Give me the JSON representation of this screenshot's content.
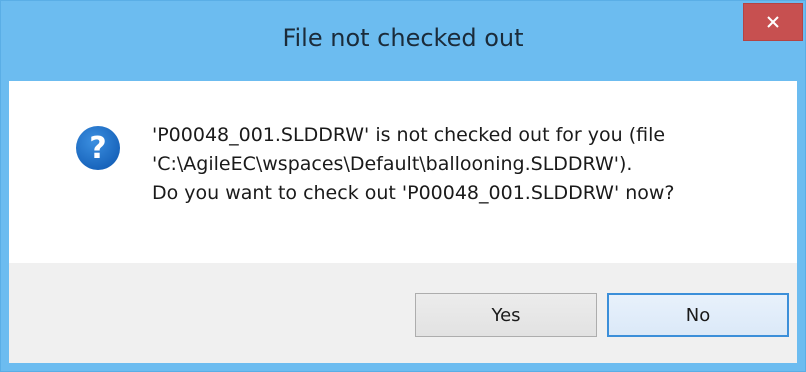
{
  "window": {
    "title": "File not checked out",
    "close_icon": "close-icon",
    "close_color": "#c75050",
    "titlebar_color": "#6cbcf0"
  },
  "message": {
    "icon": "question-icon",
    "icon_color": "#1c6fc6",
    "lines": [
      "'P00048_001.SLDDRW' is not checked out for you (file",
      "'C:\\AgileEC\\wspaces\\Default\\ballooning.SLDDRW').",
      "Do you want to check out 'P00048_001.SLDDRW' now?"
    ]
  },
  "buttons": {
    "yes_label": "Yes",
    "no_label": "No"
  }
}
